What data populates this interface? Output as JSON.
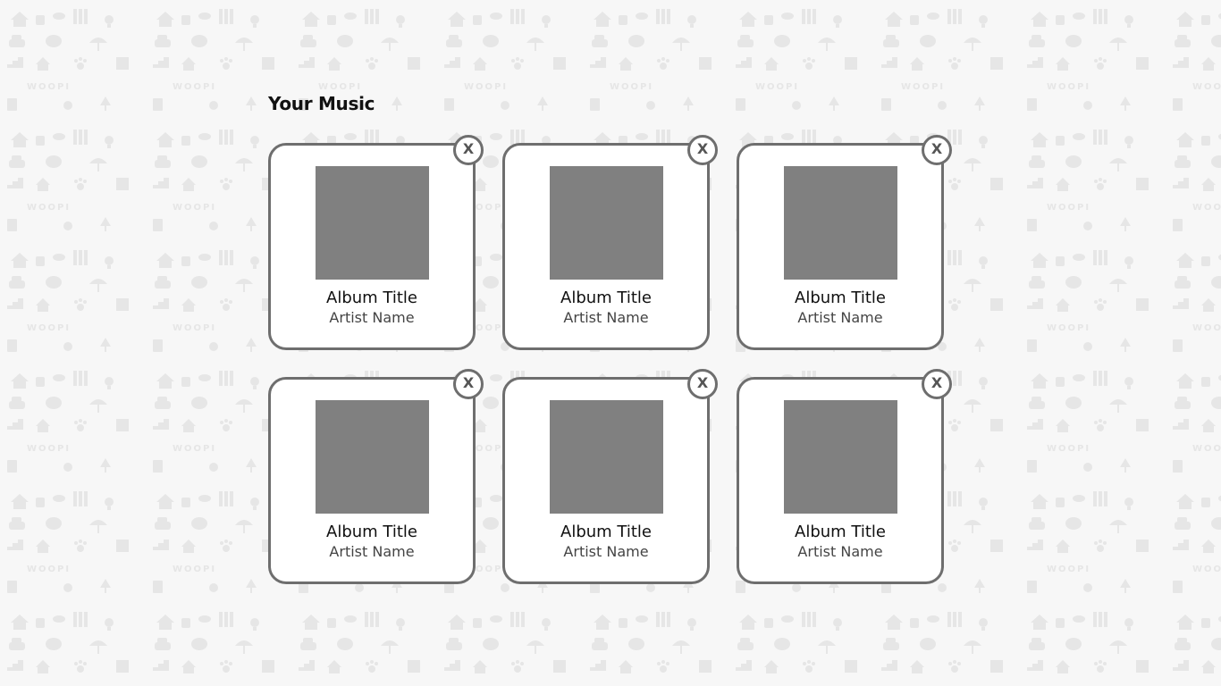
{
  "page": {
    "section_title": "Your Music"
  },
  "background": {
    "watermark_text": "WOOPI"
  },
  "albums": [
    {
      "title": "Album Title",
      "artist": "Artist Name",
      "remove_label": "X"
    },
    {
      "title": "Album Title",
      "artist": "Artist Name",
      "remove_label": "X"
    },
    {
      "title": "Album Title",
      "artist": "Artist Name",
      "remove_label": "X"
    },
    {
      "title": "Album Title",
      "artist": "Artist Name",
      "remove_label": "X"
    },
    {
      "title": "Album Title",
      "artist": "Artist Name",
      "remove_label": "X"
    },
    {
      "title": "Album Title",
      "artist": "Artist Name",
      "remove_label": "X"
    }
  ],
  "colors": {
    "background": "#f7f7f7",
    "card_border": "#6e6e6e",
    "cover_placeholder": "#808080",
    "pattern": "#e6e6e6"
  }
}
